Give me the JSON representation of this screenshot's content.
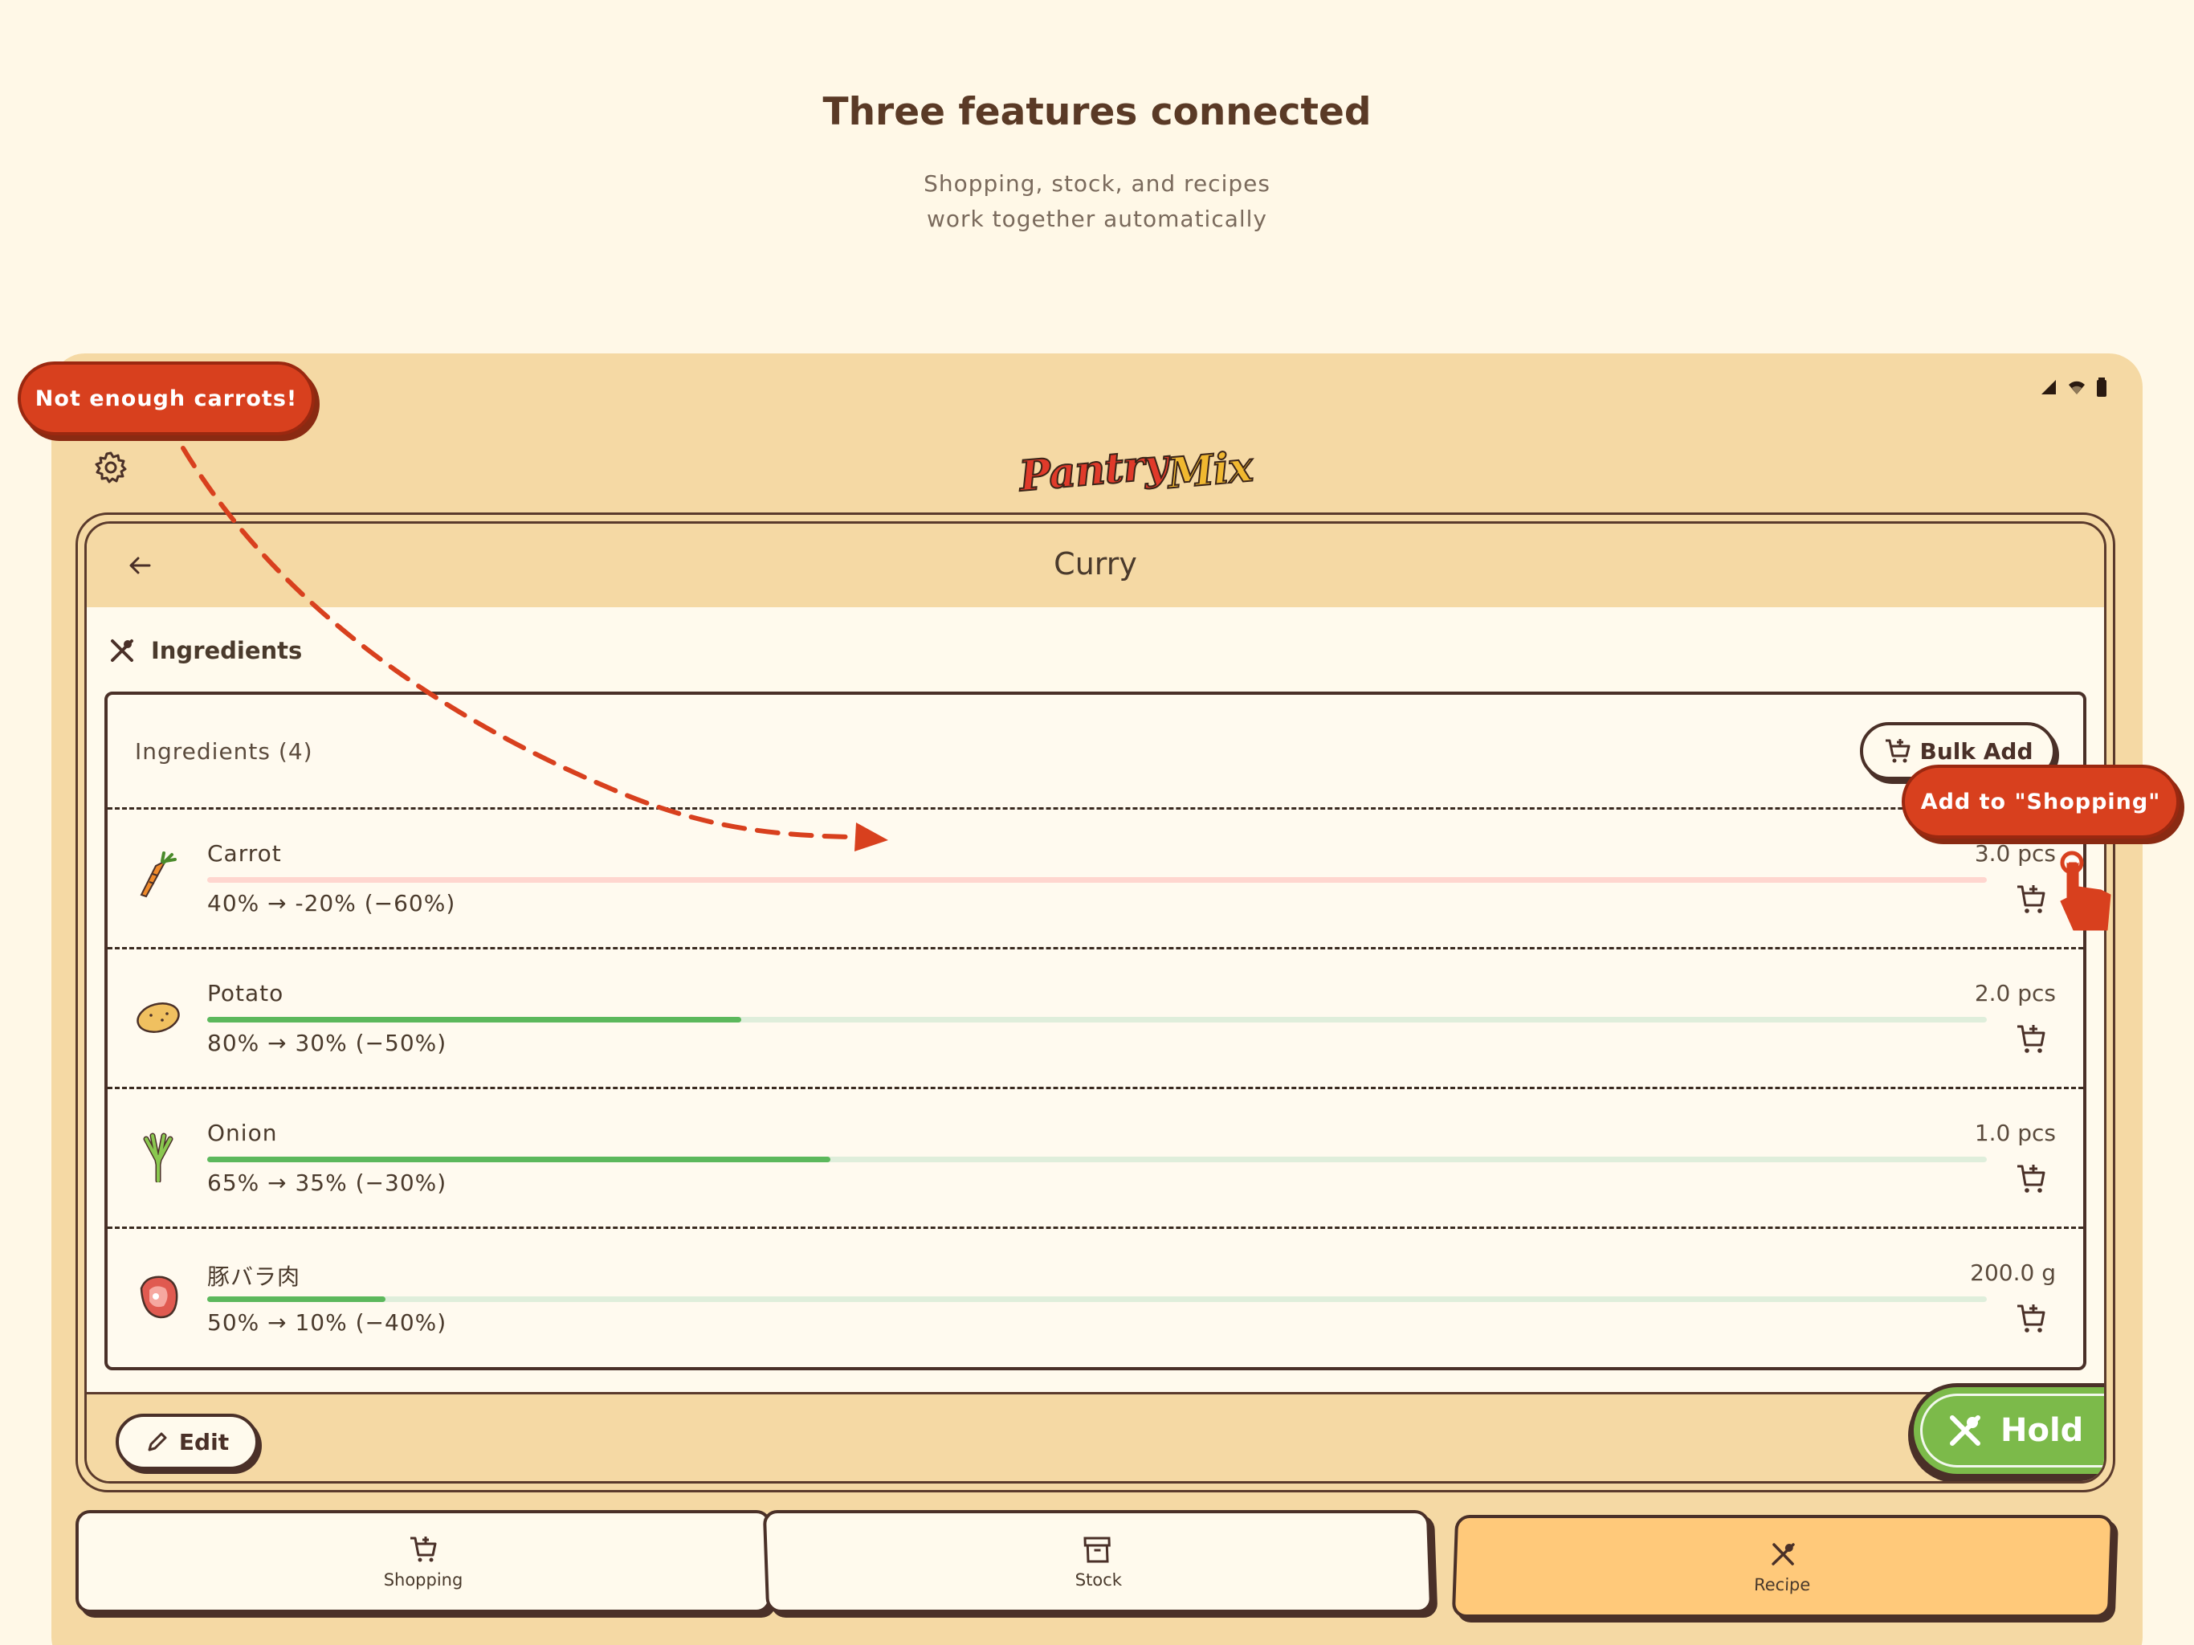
{
  "hero": {
    "title": "Three features connected",
    "subtitle_line1": "Shopping, stock, and recipes",
    "subtitle_line2": "work together automatically"
  },
  "callouts": {
    "not_enough": "Not enough carrots!",
    "add_to_shopping": "Add to \"Shopping\""
  },
  "app": {
    "logo_part1": "Pantry",
    "logo_part2": "Mix",
    "page_title": "Curry",
    "section_label": "Ingredients",
    "ingredients_count_label": "Ingredients (4)",
    "bulk_add_label": "Bulk Add",
    "edit_label": "Edit",
    "hold_label": "Hold"
  },
  "ingredients": [
    {
      "name": "Carrot",
      "qty": "3.0 pcs",
      "pct": "40% → -20% (−60%)",
      "level": 0.0,
      "icon": "carrot-icon",
      "bar_color": "#ffd6cf"
    },
    {
      "name": "Potato",
      "qty": "2.0 pcs",
      "pct": "80% → 30% (−50%)",
      "level": 0.3,
      "icon": "potato-icon",
      "bar_color": "#dfeedb"
    },
    {
      "name": "Onion",
      "qty": "1.0 pcs",
      "pct": "65% → 35% (−30%)",
      "level": 0.35,
      "icon": "onion-icon",
      "bar_color": "#dfeedb"
    },
    {
      "name": "豚バラ肉",
      "qty": "200.0 g",
      "pct": "50% → 10% (−40%)",
      "level": 0.1,
      "icon": "meat-icon",
      "bar_color": "#dfeedb"
    }
  ],
  "tabs": [
    {
      "label": "Shopping",
      "icon": "cart-icon",
      "active": false
    },
    {
      "label": "Stock",
      "icon": "archive-icon",
      "active": false
    },
    {
      "label": "Recipe",
      "icon": "utensils-icon",
      "active": true
    }
  ],
  "colors": {
    "background": "#fff8e7",
    "device": "#f5d9a4",
    "accent_red": "#d8401e",
    "progress_green": "#5cb85c",
    "hold_green": "#7cba4a",
    "active_tab": "#ffc97a"
  }
}
